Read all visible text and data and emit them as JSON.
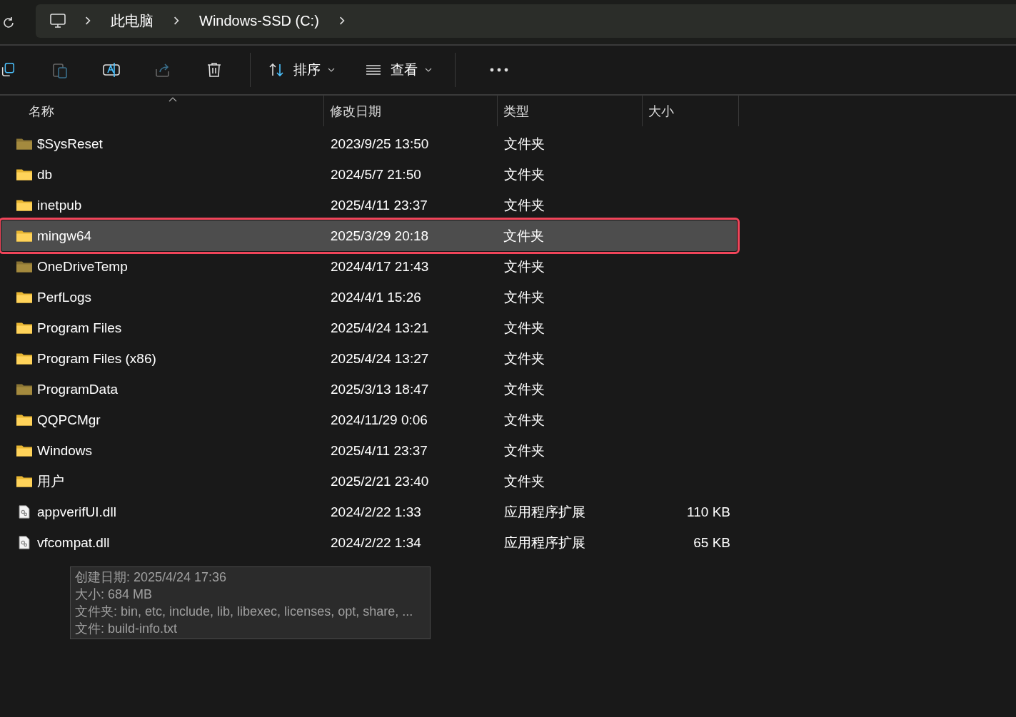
{
  "address_bar": {
    "crumbs": [
      "此电脑",
      "Windows-SSD (C:)"
    ]
  },
  "toolbar": {
    "sort_label": "排序",
    "view_label": "查看"
  },
  "table": {
    "columns": [
      "名称",
      "修改日期",
      "类型",
      "大小"
    ],
    "rows": [
      {
        "kind": "folder",
        "hidden": true,
        "selected": false,
        "name": "$SysReset",
        "date": "2023/9/25 13:50",
        "type": "文件夹"
      },
      {
        "kind": "folder",
        "hidden": false,
        "selected": false,
        "name": "db",
        "date": "2024/5/7 21:50",
        "type": "文件夹"
      },
      {
        "kind": "folder",
        "hidden": false,
        "selected": false,
        "name": "inetpub",
        "date": "2025/4/11 23:37",
        "type": "文件夹"
      },
      {
        "kind": "folder",
        "hidden": false,
        "selected": true,
        "highlighted": true,
        "name": "mingw64",
        "date": "2025/3/29 20:18",
        "type": "文件夹"
      },
      {
        "kind": "folder",
        "hidden": true,
        "selected": false,
        "name": "OneDriveTemp",
        "date": "2024/4/17 21:43",
        "type": "文件夹"
      },
      {
        "kind": "folder",
        "hidden": false,
        "selected": false,
        "name": "PerfLogs",
        "date": "2024/4/1 15:26",
        "type": "文件夹"
      },
      {
        "kind": "folder",
        "hidden": false,
        "selected": false,
        "name": "Program Files",
        "date": "2025/4/24 13:21",
        "type": "文件夹"
      },
      {
        "kind": "folder",
        "hidden": false,
        "selected": false,
        "name": "Program Files (x86)",
        "date": "2025/4/24 13:27",
        "type": "文件夹"
      },
      {
        "kind": "folder",
        "hidden": true,
        "selected": false,
        "name": "ProgramData",
        "date": "2025/3/13 18:47",
        "type": "文件夹"
      },
      {
        "kind": "folder",
        "hidden": false,
        "selected": false,
        "name": "QQPCMgr",
        "date": "2024/11/29 0:06",
        "type": "文件夹"
      },
      {
        "kind": "folder",
        "hidden": false,
        "selected": false,
        "name": "Windows",
        "date": "2025/4/11 23:37",
        "type": "文件夹"
      },
      {
        "kind": "folder",
        "hidden": false,
        "selected": false,
        "name": "用户",
        "date": "2025/2/21 23:40",
        "type": "文件夹"
      },
      {
        "kind": "file",
        "selected": false,
        "name": "appverifUI.dll",
        "date": "2024/2/22 1:33",
        "type": "应用程序扩展",
        "size": "110 KB"
      },
      {
        "kind": "file",
        "selected": false,
        "name": "vfcompat.dll",
        "date": "2024/2/22 1:34",
        "type": "应用程序扩展",
        "size": "65 KB"
      }
    ]
  },
  "tooltip": {
    "lines": [
      "创建日期: 2025/4/24 17:36",
      "大小: 684 MB",
      "文件夹: bin, etc, include, lib, libexec, licenses, opt, share, ...",
      "文件: build-info.txt"
    ]
  }
}
